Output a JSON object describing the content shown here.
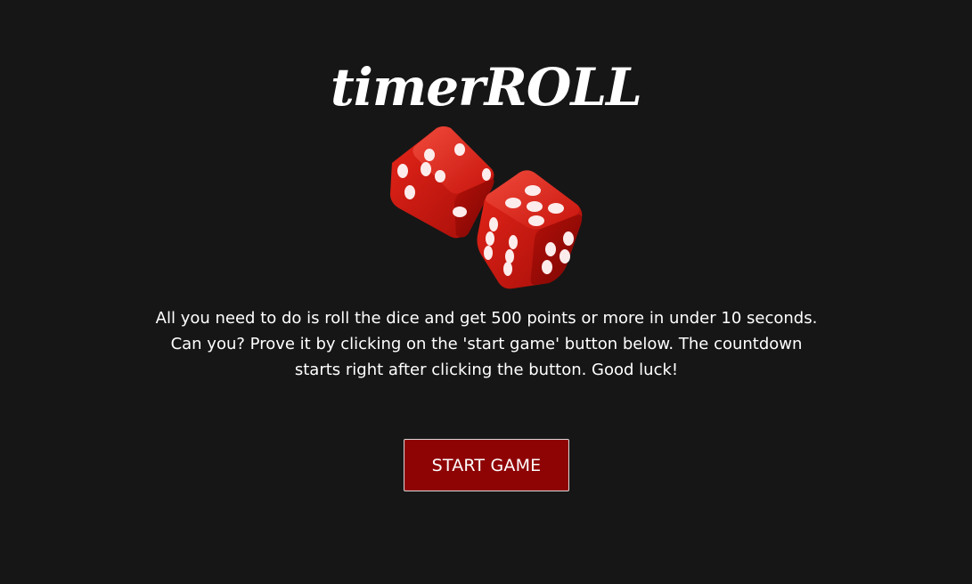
{
  "header": {
    "logo_text": "timerROLL"
  },
  "hero": {
    "image": "red-dice-pair-icon"
  },
  "intro": {
    "text": "All you need to do is roll the dice and get 500 points or more in under 10 seconds. Can you? Prove it by clicking on the 'start game' button below. The countdown starts right after clicking the button. Good luck!"
  },
  "actions": {
    "start_label": "START GAME"
  },
  "colors": {
    "background": "#171616",
    "button": "#8e0405",
    "dice": "#d4150f",
    "text": "#ffffff"
  }
}
